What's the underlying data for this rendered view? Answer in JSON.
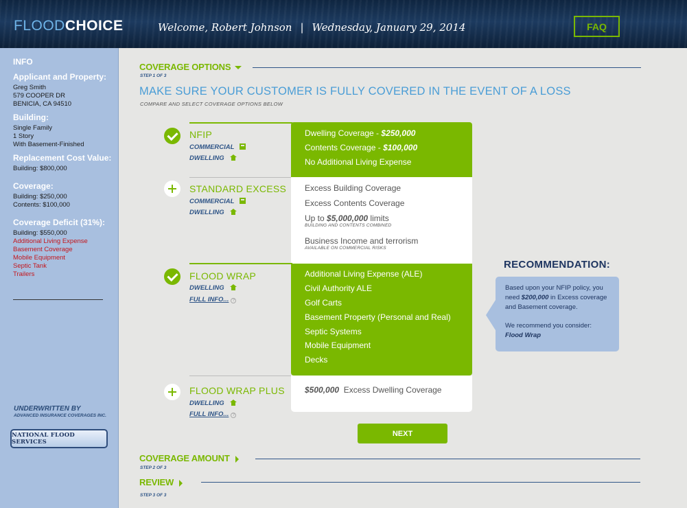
{
  "header": {
    "logo_part1": "FLOOD",
    "logo_part2": "CHOICE",
    "welcome": "Welcome, Robert Johnson",
    "separator": "|",
    "date": "Wednesday, January 29, 2014",
    "faq_label": "FAQ"
  },
  "sidebar": {
    "info_title": "INFO",
    "applicant_heading": "Applicant and Property:",
    "applicant_lines": [
      "Greg Smith",
      "579 COOPER DR",
      "BENICIA, CA 94510"
    ],
    "building_heading": "Building:",
    "building_lines": [
      "Single Family",
      "1 Story",
      "With Basement-Finished"
    ],
    "rcv_heading": "Replacement Cost Value:",
    "rcv_lines": [
      "Building: $800,000"
    ],
    "coverage_heading": "Coverage:",
    "coverage_lines": [
      "Building: $250,000",
      "Contents: $100,000"
    ],
    "deficit_heading": "Coverage Deficit (31%):",
    "deficit_line": "Building: $550,000",
    "deficit_items": [
      "Additional Living Expense",
      "Basement Coverage",
      "Mobile Equipment",
      "Septic Tank",
      "Trailers"
    ],
    "underwritten_by": "UNDERWRITTEN BY",
    "underwriter": "ADVANCED INSURANCE COVERAGES INC.",
    "nfs_logo": "NATIONAL FLOOD SERVICES"
  },
  "sections": {
    "coverage_options": {
      "title": "COVERAGE OPTIONS",
      "step": "STEP 1 OF 3"
    },
    "coverage_amount": {
      "title": "COVERAGE AMOUNT",
      "step": "STEP 2 OF 3"
    },
    "review": {
      "title": "REVIEW",
      "step": "STEP 3 OF 3"
    }
  },
  "main": {
    "headline": "MAKE SURE YOUR CUSTOMER IS FULLY COVERED IN THE EVENT OF A LOSS",
    "subhead": "COMPARE AND SELECT COVERAGE OPTIONS BELOW",
    "next_label": "NEXT"
  },
  "options": {
    "nfip": {
      "name": "NFIP",
      "sub1": "COMMERCIAL",
      "sub2": "DWELLING",
      "selected": true,
      "l1_text": "Dwelling Coverage - ",
      "l1_value": "$250,000",
      "l2_text": "Contents Coverage - ",
      "l2_value": "$100,000",
      "l3_text": "No Additional Living Expense"
    },
    "standard_excess": {
      "name": "STANDARD EXCESS",
      "sub1": "COMMERCIAL",
      "sub2": "DWELLING",
      "selected": false,
      "l1_text": "Excess Building Coverage",
      "l2_text": "Excess Contents Coverage",
      "l3_pre": "Up to ",
      "l3_value": "$5,000,000",
      "l3_post": " limits",
      "l3_note": "BUILDING AND CONTENTS COMBINED",
      "l4_text": "Business Income and terrorism",
      "l4_note": "AVAILABLE ON COMMERCIAL RISKS"
    },
    "flood_wrap": {
      "name": "FLOOD WRAP",
      "sub1": "DWELLING",
      "sub2": "FULL INFO...",
      "selected": true,
      "items": [
        "Additional Living Expense (ALE)",
        "Civil Authority ALE",
        "Golf Carts",
        "Basement Property (Personal and Real)",
        "Septic Systems",
        "Mobile Equipment",
        "Decks"
      ]
    },
    "flood_wrap_plus": {
      "name": "FLOOD WRAP PLUS",
      "sub1": "DWELLING",
      "sub2": "FULL INFO...",
      "selected": false,
      "l1_value": "$500,000",
      "l1_text": "Excess Dwelling Coverage"
    }
  },
  "recommendation": {
    "title": "RECOMMENDATION:",
    "p1_a": "Based upon your NFIP policy, you need ",
    "p1_value": "$200,000",
    "p1_b": " in Excess coverage and Basement coverage.",
    "p2": "We recommend you consider:",
    "p2_value": "Flood Wrap"
  },
  "colors": {
    "accent_green": "#7ab800",
    "navy": "#1e3560",
    "sidebar_blue": "#a8bfdf",
    "link_blue": "#4a9dd6",
    "alert_red": "#c4161c"
  }
}
